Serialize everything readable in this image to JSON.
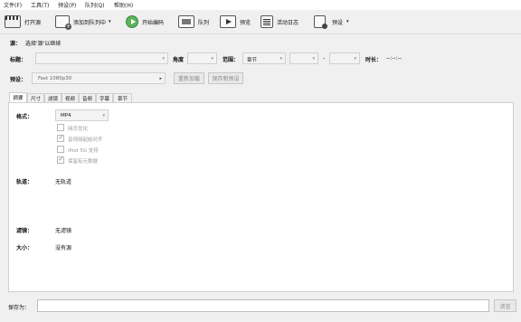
{
  "menu": [
    "文件(F)",
    "工具(T)",
    "预设(P)",
    "队列(Q)",
    "帮助(H)"
  ],
  "toolbar": {
    "open_source": "打开源",
    "add_to_queue": "添加到队列中",
    "start_encode": "开始编码",
    "queue": "队列",
    "preview": "预览",
    "activity_log": "活动日志",
    "presets": "预设",
    "dropdown_glyph": "▾"
  },
  "source": {
    "label": "源：",
    "value": "选择'源'以继续"
  },
  "title_row": {
    "title_label": "标题：",
    "angle_label": "角度",
    "range_label": "范围：",
    "range_value": "章节",
    "range_sep": "-",
    "duration_label": "时长：",
    "duration_value": "--:--:--"
  },
  "preset_row": {
    "label": "预设：",
    "value": "Fast 1080p30",
    "reload_button": "重新加载",
    "save_new_button": "保存新预设",
    "arrow_glyph": "▸"
  },
  "tabs": [
    "摘要",
    "尺寸",
    "滤镜",
    "视频",
    "音频",
    "字幕",
    "章节"
  ],
  "active_tab": 0,
  "summary": {
    "format_label": "格式：",
    "format_value": "MP4",
    "options": [
      {
        "label": "网页优化",
        "checked": false
      },
      {
        "label": "音视频起始对齐",
        "checked": true
      },
      {
        "label": "iPod 5G 支持",
        "checked": false
      },
      {
        "label": "保留有元数据",
        "checked": true
      }
    ],
    "tracks_label": "轨道：",
    "tracks_value": "无轨道",
    "filters_label": "滤镜：",
    "filters_value": "无滤镜",
    "size_label": "大小：",
    "size_value": "没有源"
  },
  "save": {
    "label": "保存为：",
    "browse_button": "浏览"
  }
}
